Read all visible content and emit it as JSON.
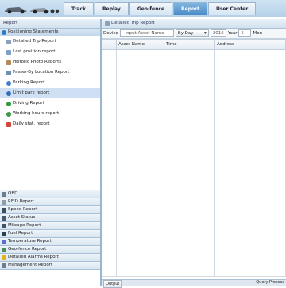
{
  "nav": {
    "tabs": [
      "Track",
      "Replay",
      "Geo-fence",
      "Report",
      "User Center"
    ],
    "active": "Report"
  },
  "left_panel": {
    "title": "Report",
    "main_section": "Positioning Statements",
    "items": [
      "Detailed Trip Report",
      "Last position report",
      "Historic Photo Reports",
      "Passer-By Location Report",
      "Parking Report",
      "Limit park report",
      "Driving Report",
      "Working hours report",
      "Daily stat. report"
    ],
    "selected": "Limit park report",
    "sections": [
      "OBD",
      "RFID Report",
      "Speed Report",
      "Asset Status",
      "Mileage Report",
      "Fuel Report",
      "Temperature Report",
      "Geo-fence Report",
      "Detailed Alarms Report",
      "Management Report"
    ]
  },
  "right_panel": {
    "tab": "Detailed Trip Report",
    "toolbar": {
      "device_label": "Device",
      "device_placeholder": "- Input Asset Name -",
      "period": "By Day",
      "year_value": "2016",
      "year_label": "Year",
      "month_value": "5",
      "month_label": "Mon"
    },
    "columns": [
      "",
      "Asset Name",
      "Time",
      "Address"
    ],
    "footer": {
      "output": "Output",
      "query": "Query Process"
    }
  },
  "colors": {
    "accent": "#4a8cc8",
    "selected_row": "#cfe0f5"
  }
}
